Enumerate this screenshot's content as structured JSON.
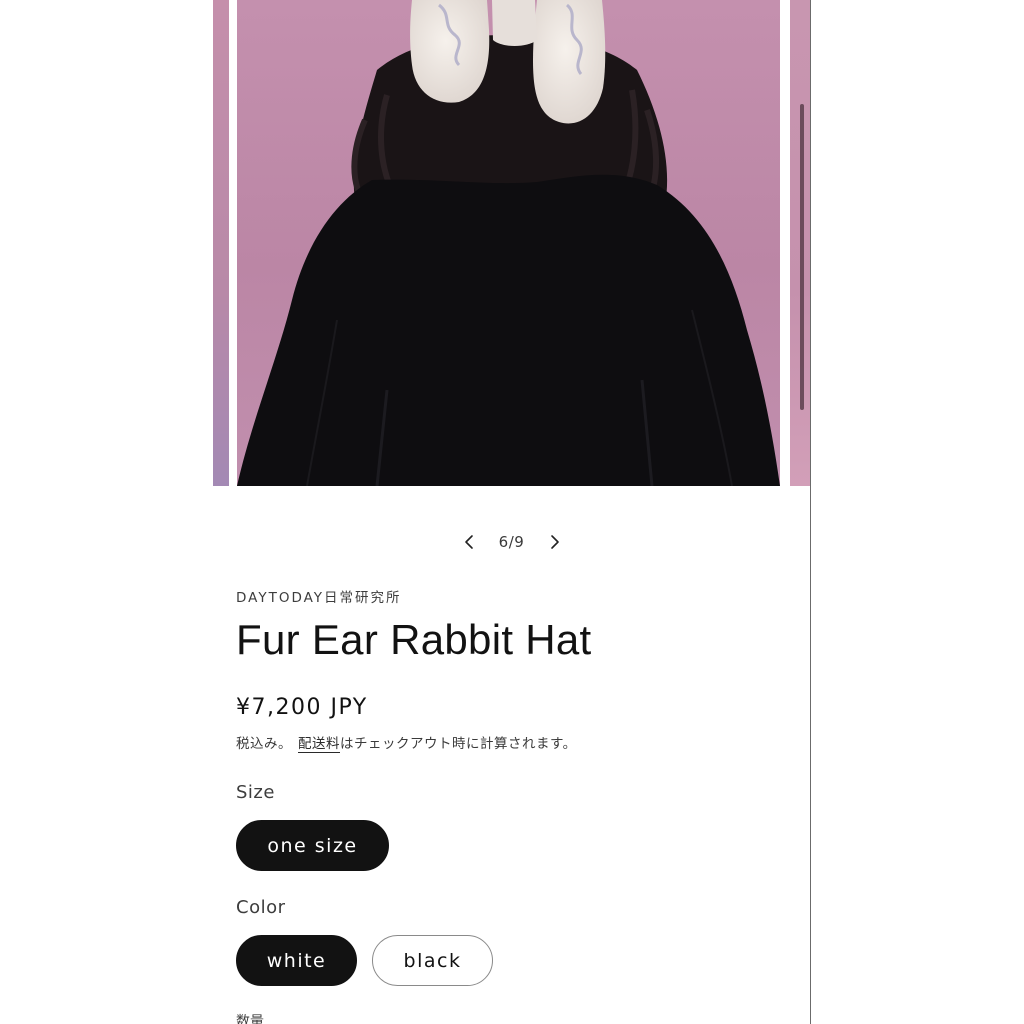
{
  "gallery": {
    "current": "6/9",
    "image_alt": "Fur Ear Rabbit Hat"
  },
  "product": {
    "vendor": "DAYTODAY日常研究所",
    "title": "Fur Ear Rabbit Hat",
    "price": "¥7,200 JPY",
    "tax_prefix": "税込み。",
    "tax_link": "配送料",
    "tax_suffix": "はチェックアウト時に計算されます。"
  },
  "options": {
    "size_label": "Size",
    "size_values": [
      "one size"
    ],
    "color_label": "Color",
    "color_values": [
      "white",
      "black"
    ],
    "quantity_label": "数量"
  },
  "colors": {
    "text": "#121212",
    "pill_active_bg": "#121212",
    "backdrop_pink": "#c08ba9",
    "sweater": "#0e0d10",
    "fur": "#efe9e4"
  },
  "icons": {
    "prev": "chevron-left-icon",
    "next": "chevron-right-icon"
  }
}
